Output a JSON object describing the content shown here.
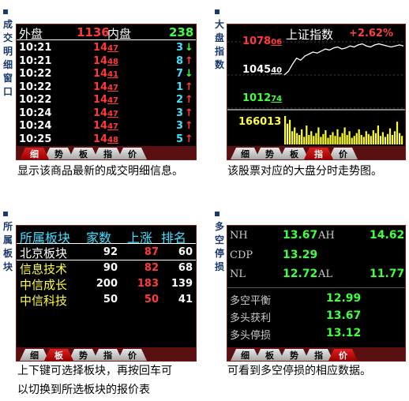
{
  "panels": {
    "trades": {
      "title": "成交明细窗口",
      "header": {
        "outer_label": "外盘",
        "outer_value": "1136",
        "inner_label": "内盘",
        "inner_value": "238"
      },
      "rows": [
        {
          "time": "10:21",
          "price_main": "14",
          "price_dec": "47",
          "vol": "3",
          "dir": "↓"
        },
        {
          "time": "10:21",
          "price_main": "14",
          "price_dec": "48",
          "vol": "8",
          "dir": "↑"
        },
        {
          "time": "10:22",
          "price_main": "14",
          "price_dec": "41",
          "vol": "7",
          "dir": "↓"
        },
        {
          "time": "10:22",
          "price_main": "14",
          "price_dec": "47",
          "vol": "1",
          "dir": "↑"
        },
        {
          "time": "10:22",
          "price_main": "14",
          "price_dec": "47",
          "vol": "2",
          "dir": "↑"
        },
        {
          "time": "10:24",
          "price_main": "14",
          "price_dec": "47",
          "vol": "3",
          "dir": "↑"
        },
        {
          "time": "10:24",
          "price_main": "14",
          "price_dec": "47",
          "vol": "3",
          "dir": "↑"
        },
        {
          "time": "10:25",
          "price_main": "14",
          "price_dec": "48",
          "vol": "5",
          "dir": "↑"
        }
      ],
      "tabs": [
        "细",
        "势",
        "板",
        "指",
        "价"
      ],
      "active_tab": 0,
      "caption": "显示该商品最新的成交明细信息。"
    },
    "index": {
      "title": "大盘指数",
      "name": "上证指数",
      "change": "+2.62%",
      "labels": {
        "high_main": "1078",
        "high_dec": "06",
        "mid_main": "1045",
        "mid_dec": "40",
        "low_main": "1012",
        "low_dec": "74",
        "volume": "166013"
      },
      "tabs": [
        "细",
        "势",
        "板",
        "指",
        "价"
      ],
      "active_tab": 3,
      "caption": "该股票对应的大盘分时走势图。"
    },
    "sectors": {
      "title": "所属板块",
      "columns": [
        "所属板块",
        "家数",
        "上涨",
        "排名"
      ],
      "rows": [
        {
          "name": "北京板块",
          "count": "92",
          "up": "87",
          "rank": "60"
        },
        {
          "name": "信息技术",
          "count": "90",
          "up": "82",
          "rank": "68"
        },
        {
          "name": "中信成长",
          "count": "200",
          "up": "183",
          "rank": "139"
        },
        {
          "name": "中信科技",
          "count": "50",
          "up": "50",
          "rank": "41"
        }
      ],
      "tabs": [
        "细",
        "板",
        "势",
        "指",
        "价"
      ],
      "active_tab": 1,
      "caption_line1": "上下键可选择板块，再按回车可",
      "caption_line2": "以切换到所选板块的报价表"
    },
    "stoploss": {
      "title": "多空停损",
      "top": {
        "nh_label": "NH",
        "nh_value": "13.67",
        "ah_label": "AH",
        "ah_value": "14.62",
        "cdp_label": "CDP",
        "cdp_value": "13.29",
        "nl_label": "NL",
        "nl_value": "12.72",
        "al_label": "AL",
        "al_value": "11.77"
      },
      "bottom": [
        {
          "label": "多空平衡",
          "value": "12.99"
        },
        {
          "label": "多头获利",
          "value": "13.67"
        },
        {
          "label": "多头停损",
          "value": "13.12"
        }
      ],
      "tabs": [
        "细",
        "板",
        "势",
        "指",
        "价"
      ],
      "active_tab": 4,
      "caption": "可看到多空停损的相应数据。"
    }
  },
  "chart_data": {
    "type": "line",
    "title": "上证指数",
    "y_tick_labels": [
      "107806",
      "104540",
      "101274"
    ],
    "ylim": [
      1012.74,
      1078.06
    ],
    "series": [
      {
        "values": [
          1045.4,
          1049,
          1056,
          1062,
          1060,
          1064,
          1066,
          1068,
          1067,
          1069,
          1071,
          1070,
          1072,
          1073,
          1071,
          1072,
          1074,
          1073,
          1075,
          1076,
          1074,
          1073,
          1075,
          1076,
          1075,
          1074,
          1073,
          1074,
          1075,
          1074
        ]
      }
    ]
  }
}
